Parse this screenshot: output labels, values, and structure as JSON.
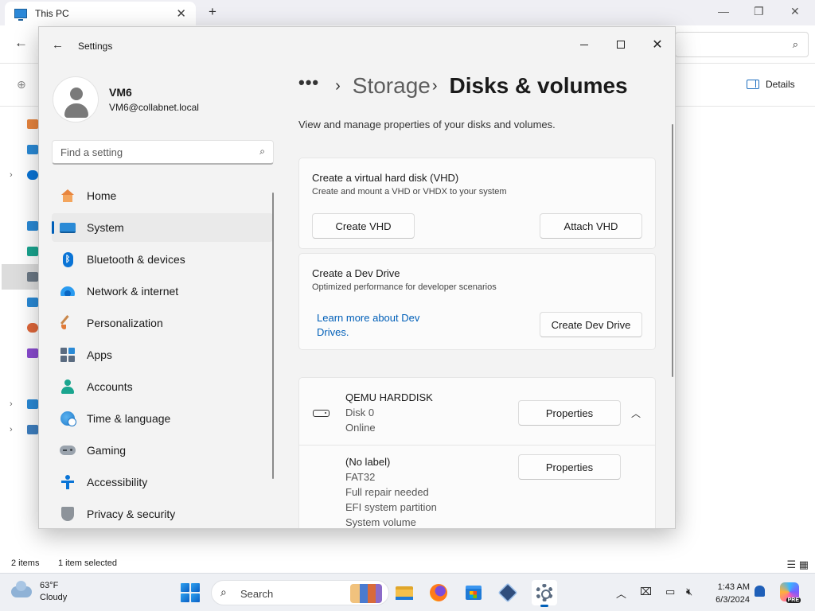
{
  "explorer": {
    "tab_title": "This PC",
    "status_items": "2 items",
    "status_selected": "1 item selected",
    "details_label": "Details"
  },
  "settings": {
    "window_title": "Settings",
    "user": {
      "name": "VM6",
      "email": "VM6@collabnet.local"
    },
    "search": {
      "placeholder": "Find a setting"
    },
    "nav": [
      {
        "label": "Home",
        "icon": "home-icon"
      },
      {
        "label": "System",
        "icon": "system-icon",
        "selected": true
      },
      {
        "label": "Bluetooth & devices",
        "icon": "bluetooth-icon"
      },
      {
        "label": "Network & internet",
        "icon": "wifi-icon"
      },
      {
        "label": "Personalization",
        "icon": "brush-icon"
      },
      {
        "label": "Apps",
        "icon": "apps-icon"
      },
      {
        "label": "Accounts",
        "icon": "account-icon"
      },
      {
        "label": "Time & language",
        "icon": "globe-clock-icon"
      },
      {
        "label": "Gaming",
        "icon": "gamepad-icon"
      },
      {
        "label": "Accessibility",
        "icon": "accessibility-icon"
      },
      {
        "label": "Privacy & security",
        "icon": "shield-icon"
      }
    ],
    "breadcrumb": {
      "more": "•••",
      "parent": "Storage",
      "current": "Disks & volumes"
    },
    "subtitle": "View and manage properties of your disks and volumes.",
    "vhd_card": {
      "title": "Create a virtual hard disk (VHD)",
      "description": "Create and mount a VHD or VHDX to your system",
      "create_label": "Create VHD",
      "attach_label": "Attach VHD"
    },
    "dev_card": {
      "title": "Create a Dev Drive",
      "description": "Optimized performance for developer scenarios",
      "link_line1": "Learn more about Dev",
      "link_line2": "Drives.",
      "create_label": "Create Dev Drive"
    },
    "disk": {
      "name": "QEMU HARDDISK",
      "number": "Disk 0",
      "status": "Online",
      "properties_label": "Properties",
      "volume": {
        "label": "(No label)",
        "filesystem": "FAT32",
        "health": "Full repair needed",
        "type": "EFI system partition",
        "role": "System volume",
        "properties_label": "Properties"
      }
    }
  },
  "taskbar": {
    "weather_temp": "63°F",
    "weather_desc": "Cloudy",
    "search_label": "Search",
    "time": "1:43 AM",
    "date": "6/3/2024",
    "copilot_badge": "PRE"
  },
  "colors": {
    "accent": "#005fb8",
    "window_bg": "#f3f3f3",
    "card_bg": "#fbfbfb"
  }
}
